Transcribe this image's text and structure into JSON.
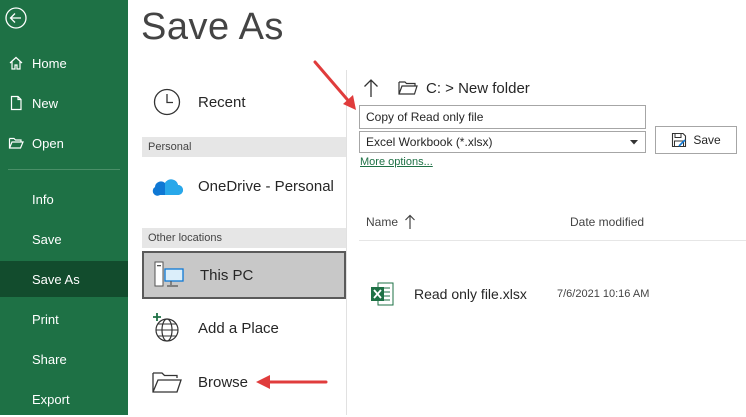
{
  "window": {
    "title": "Save As"
  },
  "sidebar": {
    "items": [
      {
        "label": "Home",
        "icon": "home-icon"
      },
      {
        "label": "New",
        "icon": "new-document-icon"
      },
      {
        "label": "Open",
        "icon": "open-folder-icon"
      },
      {
        "label": "Info"
      },
      {
        "label": "Save"
      },
      {
        "label": "Save As",
        "active": true
      },
      {
        "label": "Print"
      },
      {
        "label": "Share"
      },
      {
        "label": "Export"
      }
    ],
    "back_icon": "back-arrow-icon",
    "background_color": "#1e7145",
    "active_color": "#124c2d"
  },
  "locations": {
    "recent": "Recent",
    "personal_header": "Personal",
    "onedrive": "OneDrive - Personal",
    "other_header": "Other locations",
    "this_pc": "This PC",
    "add_place": "Add a Place",
    "browse": "Browse"
  },
  "right_panel": {
    "path": "C: > New folder",
    "filename_value": "Copy of Read only file",
    "filetype_value": "Excel Workbook (*.xlsx)",
    "more_options": "More options...",
    "save_button": "Save",
    "columns": {
      "name": "Name",
      "date": "Date modified"
    },
    "files": [
      {
        "name": "Read only file.xlsx",
        "date": "7/6/2021 10:16 AM",
        "icon": "excel-file-icon"
      }
    ]
  },
  "annotations": {
    "arrow_color": "#e03c3c"
  }
}
